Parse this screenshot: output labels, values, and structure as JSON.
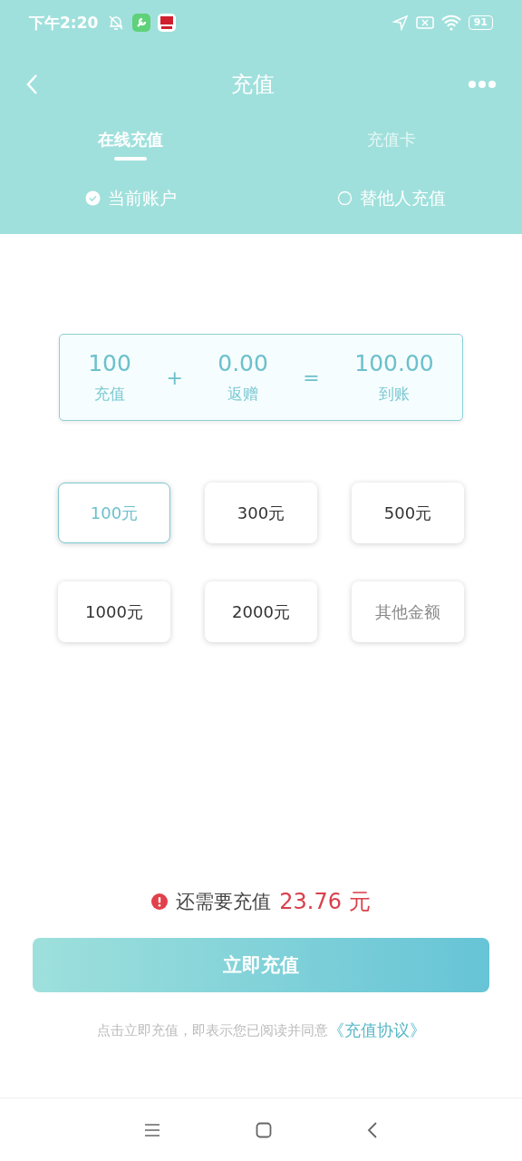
{
  "status_bar": {
    "time": "下午2:20",
    "battery": "91"
  },
  "nav": {
    "title": "充值"
  },
  "tabs": [
    {
      "label": "在线充值",
      "selected": true
    },
    {
      "label": "充值卡",
      "selected": false
    }
  ],
  "targets": [
    {
      "label": "当前账户",
      "selected": true
    },
    {
      "label": "替他人充值",
      "selected": false
    }
  ],
  "summary": {
    "items": [
      {
        "value": "100",
        "label": "充值"
      },
      {
        "value": "0.00",
        "label": "返赠"
      },
      {
        "value": "100.00",
        "label": "到账"
      }
    ],
    "operators": [
      "+",
      "="
    ]
  },
  "amounts": [
    {
      "label": "100元",
      "selected": true,
      "kind": "amount"
    },
    {
      "label": "300元",
      "selected": false,
      "kind": "amount"
    },
    {
      "label": "500元",
      "selected": false,
      "kind": "amount"
    },
    {
      "label": "1000元",
      "selected": false,
      "kind": "amount"
    },
    {
      "label": "2000元",
      "selected": false,
      "kind": "amount"
    },
    {
      "label": "其他金额",
      "selected": false,
      "kind": "other"
    }
  ],
  "notice": {
    "text": "还需要充值",
    "amount": "23.76",
    "unit": "元"
  },
  "submit": "立即充值",
  "agreement": {
    "text": "点击立即充值，即表示您已阅读并同意",
    "link": "《充值协议》"
  }
}
